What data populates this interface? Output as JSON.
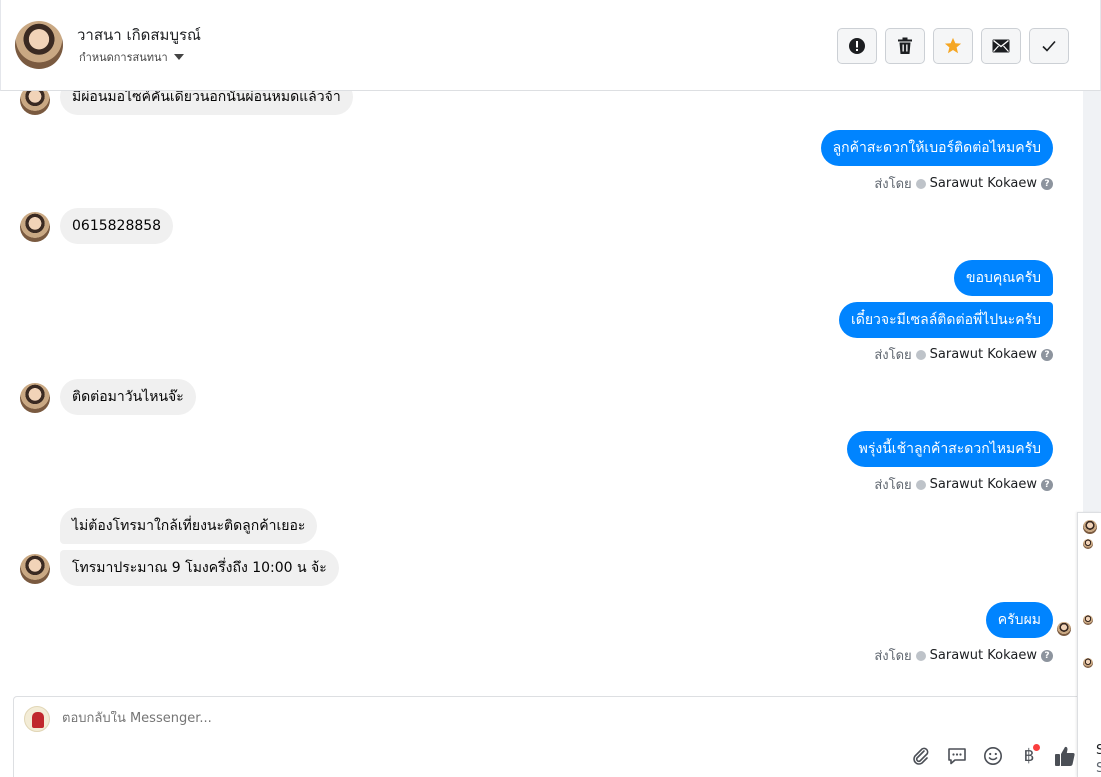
{
  "header": {
    "contact_name": "วาสนา เกิดสมบูรณ์",
    "assign_label": "กำหนดการสนทนา",
    "actions": [
      {
        "name": "mark-spam-button",
        "icon": "exclamation-circle-icon"
      },
      {
        "name": "delete-button",
        "icon": "trash-icon"
      },
      {
        "name": "star-button",
        "icon": "star-icon",
        "color": "#f5a623"
      },
      {
        "name": "mark-unread-button",
        "icon": "envelope-icon"
      },
      {
        "name": "mark-done-button",
        "icon": "check-icon"
      }
    ]
  },
  "messages": {
    "m0": "มีผ่อนมอไซค์คันเดียวนอกนั้นผ่อนหมดแล้วจ้า",
    "m1": "ลูกค้าสะดวกให้เบอร์ติดต่อไหมครับ",
    "m2": "0615828858",
    "m3": "ขอบคุณครับ",
    "m4": "เดี๋ยวจะมีเซลล์ติดต่อพี่ไปนะครับ",
    "m5": "ติดต่อมาวันไหนจ๊ะ",
    "m6": "พรุ่งนี้เช้าลูกค้าสะดวกไหมครับ",
    "m7": "ไม่ต้องโทรมาใกล้เที่ยงนะติดลูกค้าเยอะ",
    "m8": "โทรมาประมาณ 9 โมงครึ่งถึง 10:00 น จ้ะ",
    "m9": "ครับผม"
  },
  "sent_by": {
    "label": "ส่งโดย",
    "agent": "Sarawut Kokaew"
  },
  "composer": {
    "placeholder": "ตอบกลับใน Messenger...",
    "currency_symbol": "฿"
  },
  "side_panel": {
    "cut_text_1": "S",
    "cut_text_2": "S"
  },
  "colors": {
    "outgoing_bubble": "#0084ff",
    "incoming_bubble": "#f0f0f0",
    "like_icon": "#4b4f56"
  }
}
